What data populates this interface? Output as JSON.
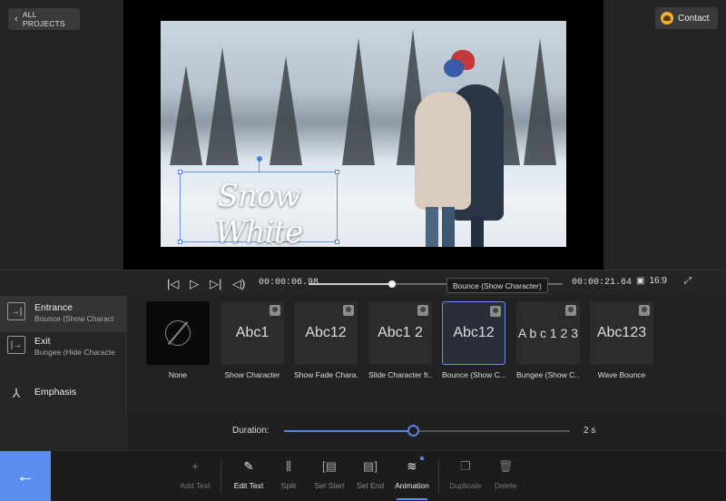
{
  "header": {
    "back_label": "ALL PROJECTS",
    "contact_label": "Contact"
  },
  "video": {
    "title_text": "Snow White"
  },
  "player": {
    "current_time": "00:00:06.98",
    "total_time": "00:00:21.64",
    "ratio": "16:9",
    "progress": 0.33,
    "tooltip": "Bounce (Show Character)"
  },
  "sidebar": {
    "items": [
      {
        "label": "Entrance",
        "sub": "Bounce (Show Charact",
        "icon": "entrance-icon"
      },
      {
        "label": "Exit",
        "sub": "Bungee (Hide Characte",
        "icon": "exit-icon"
      },
      {
        "label": "Emphasis",
        "sub": "",
        "icon": "emphasis-icon"
      }
    ]
  },
  "effects": [
    {
      "name": "None",
      "preview": ""
    },
    {
      "name": "Show Character",
      "preview": "Abc1"
    },
    {
      "name": "Show Fade Chara...",
      "preview": "Abc12"
    },
    {
      "name": "Slide Character fr...",
      "preview": "Abc1 2"
    },
    {
      "name": "Bounce (Show C...",
      "preview": "Abc12"
    },
    {
      "name": "Bungee (Show C...",
      "preview": "A b c 1 2 3"
    },
    {
      "name": "Wave Bounce",
      "preview": "Abc123"
    }
  ],
  "duration": {
    "label": "Duration:",
    "value": "2 s",
    "level": 0.45
  },
  "toolbar": {
    "add_text": "Add Text",
    "edit_text": "Edit Text",
    "split": "Split",
    "set_start": "Set Start",
    "set_end": "Set End",
    "animation": "Animation",
    "duplicate": "Duplicate",
    "delete": "Delete"
  },
  "colors": {
    "accent": "#5b8ef0"
  }
}
